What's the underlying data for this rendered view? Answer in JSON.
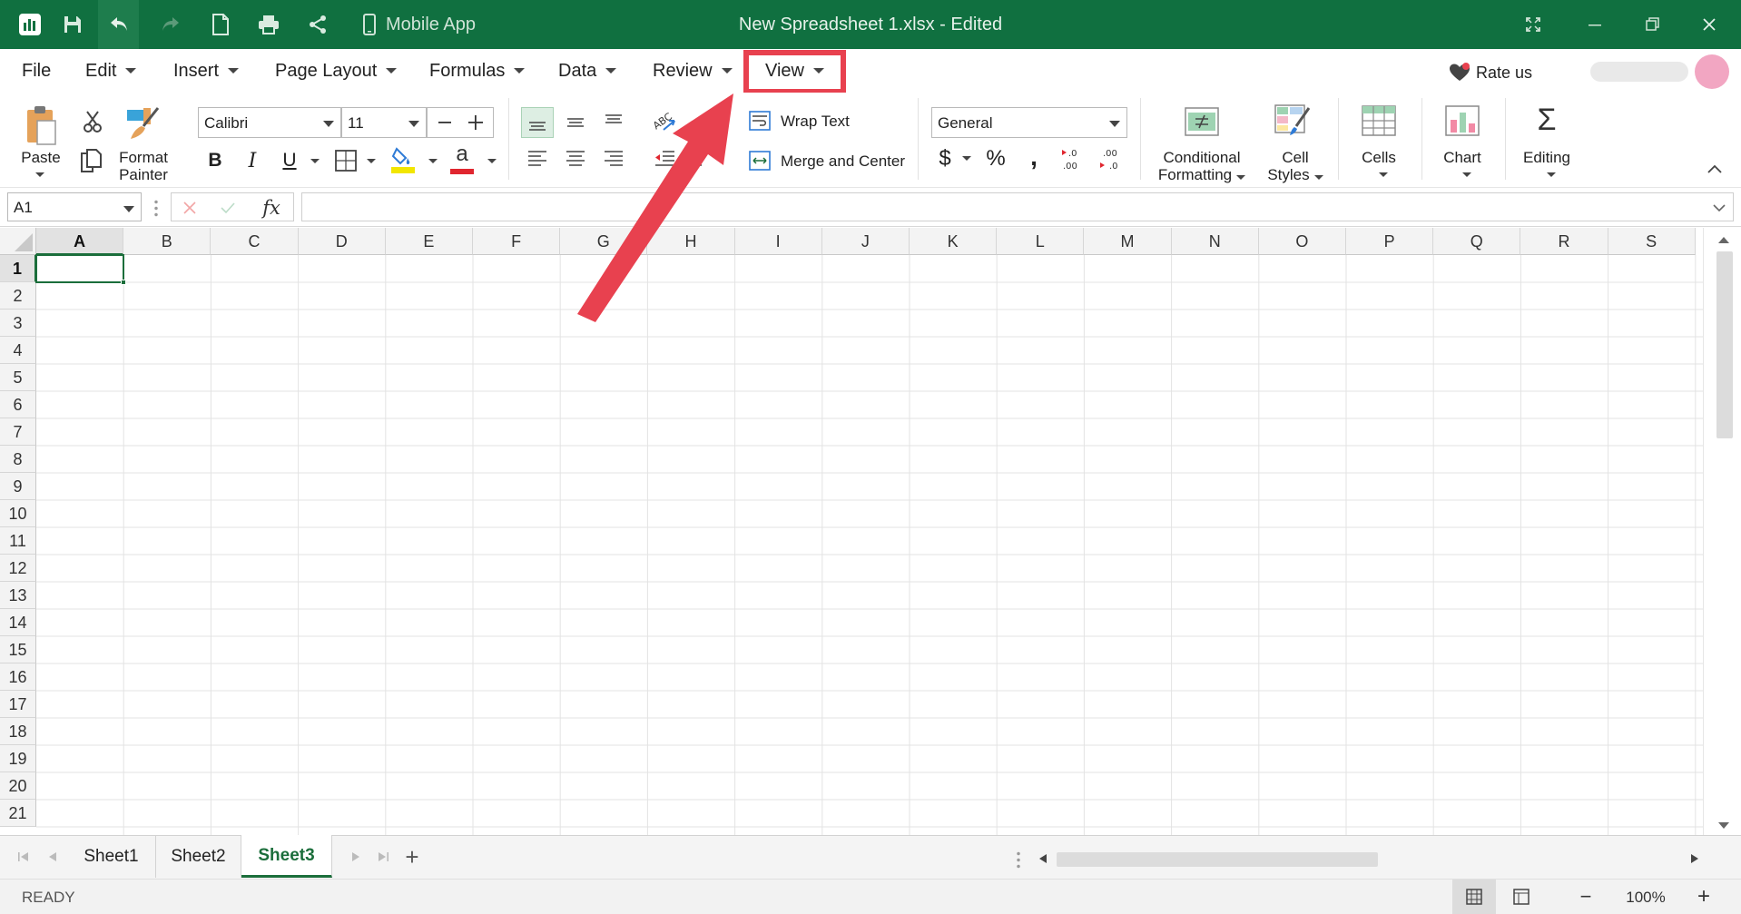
{
  "titlebar": {
    "app_title": "New Spreadsheet 1.xlsx - Edited",
    "mobile_app_label": "Mobile App",
    "brand_color": "#107040",
    "icons": [
      "app-logo-icon",
      "save-icon",
      "undo-icon",
      "redo-icon",
      "new-file-icon",
      "print-icon",
      "share-icon",
      "mobile-icon",
      "fullscreen-icon",
      "minimize-icon",
      "restore-icon",
      "close-icon"
    ]
  },
  "menu": {
    "items": [
      {
        "label": "File"
      },
      {
        "label": "Edit"
      },
      {
        "label": "Insert"
      },
      {
        "label": "Page Layout"
      },
      {
        "label": "Formulas"
      },
      {
        "label": "Data"
      },
      {
        "label": "Review"
      },
      {
        "label": "View"
      }
    ],
    "highlighted_item": "View",
    "highlight_color": "#e8414f",
    "rate_us": "Rate us"
  },
  "ribbon": {
    "paste": "Paste",
    "format_painter": [
      "Format",
      "Painter"
    ],
    "font_name": "Calibri",
    "font_size": "11",
    "bold": "B",
    "italic": "I",
    "underline": "U",
    "font_color_glyph": "a",
    "font_color": "#e0262f",
    "fill_color": "#f2e600",
    "wrap_text": "Wrap Text",
    "merge_center": "Merge and Center",
    "number_format": "General",
    "currency_symbol": "$",
    "percent_symbol": "%",
    "comma_symbol": ",",
    "conditional_formatting": [
      "Conditional",
      "Formatting"
    ],
    "cell_styles": [
      "Cell",
      "Styles"
    ],
    "cells": "Cells",
    "chart": "Chart",
    "editing": "Editing",
    "sigma": "Σ"
  },
  "formula_bar": {
    "name_box": "A1",
    "fx": "fx",
    "formula_value": ""
  },
  "grid": {
    "columns": [
      "A",
      "B",
      "C",
      "D",
      "E",
      "F",
      "G",
      "H",
      "I",
      "J",
      "K",
      "L",
      "M",
      "N",
      "O",
      "P",
      "Q",
      "R",
      "S"
    ],
    "rows": [
      "1",
      "2",
      "3",
      "4",
      "5",
      "6",
      "7",
      "8",
      "9",
      "10",
      "11",
      "12",
      "13",
      "14",
      "15",
      "16",
      "17",
      "18",
      "19",
      "20",
      "21"
    ],
    "selected_cell": "A1",
    "selection_color": "#1b6e3b"
  },
  "sheets": {
    "tabs": [
      {
        "label": "Sheet1"
      },
      {
        "label": "Sheet2"
      },
      {
        "label": "Sheet3"
      }
    ],
    "active": "Sheet3",
    "add_symbol": "+"
  },
  "status": {
    "ready": "READY",
    "zoom": "100%",
    "zoom_out": "−",
    "zoom_in": "+"
  }
}
